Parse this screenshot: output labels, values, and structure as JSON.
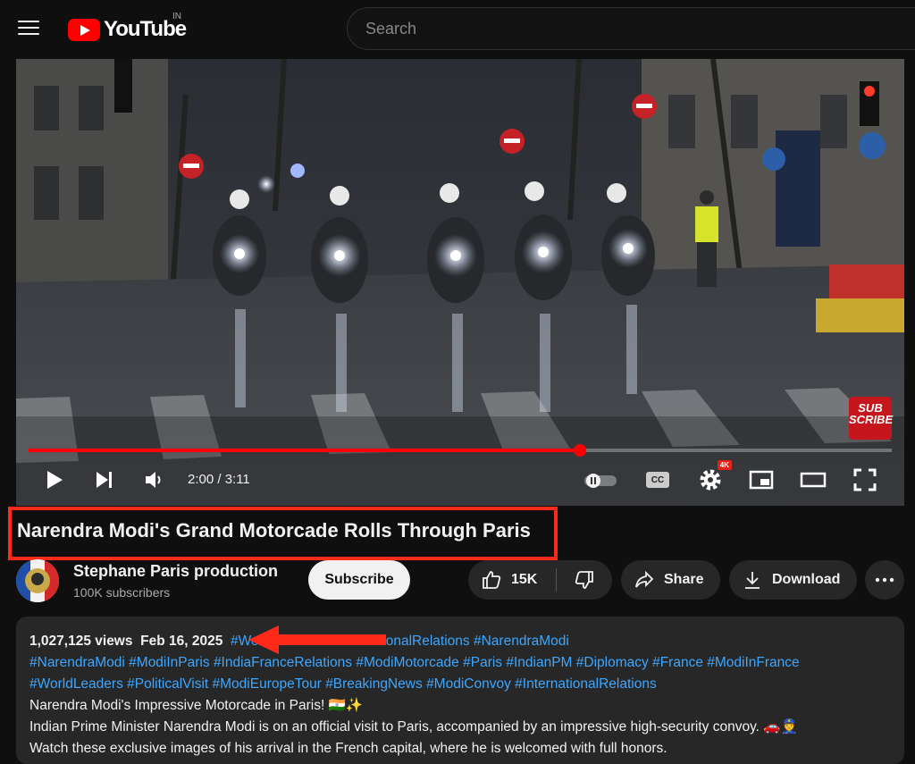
{
  "header": {
    "logo_text": "YouTube",
    "region": "IN",
    "search_placeholder": "Search"
  },
  "player": {
    "time_display": "2:00 / 3:11",
    "progress_fraction": 0.639,
    "subscribe_overlay": "SUB SCRIBE",
    "quality_badge": "4K",
    "cc_label": "CC"
  },
  "video": {
    "title": "Narendra Modi's Grand Motorcade Rolls Through Paris"
  },
  "channel": {
    "name": "Stephane Paris production",
    "subscribers": "100K subscribers",
    "subscribe_label": "Subscribe"
  },
  "actions": {
    "likes": "15K",
    "share": "Share",
    "download": "Download"
  },
  "description": {
    "views": "1,027,125 views",
    "date": "Feb 16, 2025",
    "line1_tags": [
      "#WorldLeaders",
      "#InternationalRelations",
      "#NarendraModi"
    ],
    "line2_tags": [
      "#NarendraModi",
      "#ModiInParis",
      "#IndiaFranceRelations",
      "#ModiMotorcade",
      "#Paris",
      "#IndianPM",
      "#Diplomacy",
      "#France",
      "#ModiInFrance"
    ],
    "line3_tags": [
      "#WorldLeaders",
      "#PoliticalVisit",
      "#ModiEuropeTour",
      "#BreakingNews",
      "#ModiConvoy",
      "#InternationalRelations"
    ],
    "text1": "Narendra Modi's Impressive Motorcade in Paris! 🇮🇳✨",
    "text2": "Indian Prime Minister Narendra Modi is on an official visit to Paris, accompanied by an impressive high-security convoy. 🚗👮",
    "text3": "Watch these exclusive images of his arrival in the French capital, where he is welcomed with full honors."
  },
  "colors": {
    "accent_red": "#ff0000",
    "hashtag_blue": "#3ea6ff",
    "annotation_red": "#ff2a1a"
  }
}
